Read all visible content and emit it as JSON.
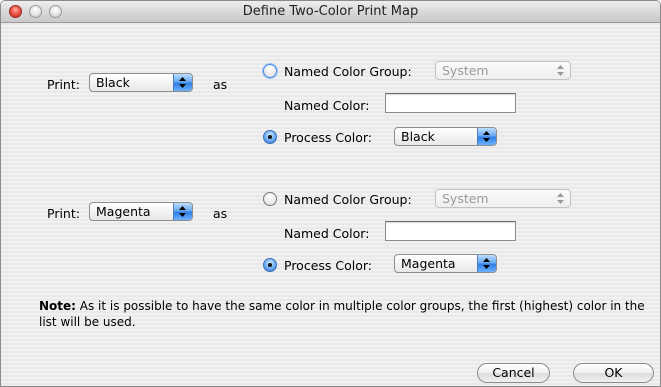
{
  "window": {
    "title": "Define Two-Color Print Map"
  },
  "mappings": [
    {
      "print_label": "Print:",
      "print_value": "Black",
      "as_label": "as",
      "named_group_label": "Named Color Group:",
      "named_group_value": "System",
      "named_color_label": "Named Color:",
      "named_color_value": "",
      "process_label": "Process Color:",
      "process_value": "Black",
      "selected": "process"
    },
    {
      "print_label": "Print:",
      "print_value": "Magenta",
      "as_label": "as",
      "named_group_label": "Named Color Group:",
      "named_group_value": "System",
      "named_color_label": "Named Color:",
      "named_color_value": "",
      "process_label": "Process Color:",
      "process_value": "Magenta",
      "selected": "process"
    }
  ],
  "note": {
    "bold": "Note:",
    "text": " As it is possible to have the same color in multiple color groups, the first (highest) color in the list will be used."
  },
  "buttons": {
    "cancel": "Cancel",
    "ok": "OK"
  },
  "icons": {
    "close": "close-icon",
    "minimize": "minimize-icon",
    "zoom": "zoom-icon",
    "popup_arrows": "updown-arrows-icon"
  }
}
